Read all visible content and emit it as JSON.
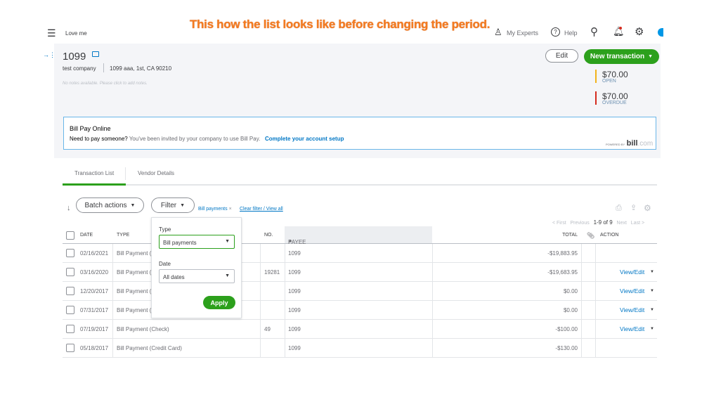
{
  "annotation": "This how the list looks like before changing the period.",
  "topnav": {
    "company": "Love me",
    "my_experts": "My Experts",
    "help": "Help"
  },
  "vendor": {
    "name": "1099",
    "company": "test company",
    "address": "1099 aaa, 1st, CA 90210",
    "notes": "No notes available. Please click to add notes.",
    "edit": "Edit",
    "new_transaction": "New transaction",
    "open_amount": "$70.00",
    "open_label": "OPEN",
    "overdue_amount": "$70.00",
    "overdue_label": "OVERDUE",
    "open_color": "#f2b31b",
    "overdue_color": "#d52b1e"
  },
  "billpay": {
    "title": "Bill Pay Online",
    "lead": "Need to pay someone?",
    "text": "You've been invited by your company to use Bill Pay.",
    "link": "Complete your account setup",
    "powered": "POWERED BY",
    "brand": "bill",
    "brand_suffix": ".com"
  },
  "tabs": [
    {
      "label": "Transaction List",
      "active": true
    },
    {
      "label": "Vendor Details",
      "active": false
    }
  ],
  "toolbar": {
    "batch": "Batch actions",
    "filter": "Filter",
    "filter_chip": "Bill payments",
    "clear": "Clear filter / View all"
  },
  "pagination": {
    "first": "< First",
    "previous": "Previous",
    "range": "1-9 of 9",
    "next": "Next",
    "last": "Last >"
  },
  "columns": {
    "date": "DATE",
    "type": "TYPE",
    "no": "NO.",
    "payee": "PAYEE",
    "total": "TOTAL",
    "action": "ACTION"
  },
  "rows": [
    {
      "date": "02/16/2021",
      "type": "Bill Payment (C",
      "no": "",
      "payee": "1099",
      "total": "-$19,883.95",
      "action": ""
    },
    {
      "date": "03/16/2020",
      "type": "Bill Payment (C",
      "no": "19281",
      "payee": "1099",
      "total": "-$19,683.95",
      "action": "View/Edit"
    },
    {
      "date": "12/20/2017",
      "type": "Bill Payment (C",
      "no": "",
      "payee": "1099",
      "total": "$0.00",
      "action": "View/Edit"
    },
    {
      "date": "07/31/2017",
      "type": "Bill Payment (C",
      "no": "",
      "payee": "1099",
      "total": "$0.00",
      "action": "View/Edit"
    },
    {
      "date": "07/19/2017",
      "type": "Bill Payment (Check)",
      "no": "49",
      "payee": "1099",
      "total": "-$100.00",
      "action": "View/Edit"
    },
    {
      "date": "05/18/2017",
      "type": "Bill Payment (Credit Card)",
      "no": "",
      "payee": "1099",
      "total": "-$130.00",
      "action": ""
    }
  ],
  "filter_popup": {
    "type_label": "Type",
    "type_value": "Bill payments",
    "date_label": "Date",
    "date_value": "All dates",
    "apply": "Apply"
  }
}
